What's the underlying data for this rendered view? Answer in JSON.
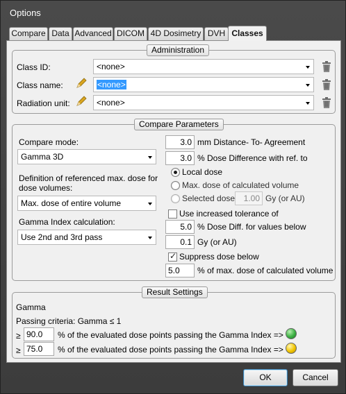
{
  "window": {
    "title": "Options"
  },
  "tabs": [
    {
      "label": "Compare"
    },
    {
      "label": "Data"
    },
    {
      "label": "Advanced"
    },
    {
      "label": "DICOM"
    },
    {
      "label": "4D Dosimetry"
    },
    {
      "label": "DVH"
    },
    {
      "label": "Classes"
    }
  ],
  "active_tab": "Classes",
  "administration": {
    "title": "Administration",
    "class_id": {
      "label": "Class ID:",
      "value": "<none>"
    },
    "class_name": {
      "label": "Class name:",
      "value": "<none>"
    },
    "radiation_unit": {
      "label": "Radiation unit:",
      "value": "<none>"
    }
  },
  "compare": {
    "title": "Compare Parameters",
    "mode_label": "Compare mode:",
    "mode_value": "Gamma 3D",
    "def_label_1": "Definition of referenced max. dose for",
    "def_label_2": "dose volumes:",
    "def_value": "Max. dose of entire volume",
    "gamma_calc_label": "Gamma Index calculation:",
    "gamma_calc_value": "Use 2nd and 3rd pass",
    "dta_value": "3.0",
    "dta_label": "mm Distance- To- Agreement",
    "dd_value": "3.0",
    "dd_label": "% Dose Difference with ref. to",
    "local_dose_label": "Local dose",
    "max_calc_label": "Max. dose of calculated volume",
    "selected_dose_label": "Selected dose",
    "selected_dose_value": "1.00",
    "selected_dose_unit": "Gy (or AU)",
    "increased_tol_label": "Use increased tolerance of",
    "tol_diff_value": "5.0",
    "tol_diff_label": "% Dose Diff. for values below",
    "tol_gy_value": "0.1",
    "tol_gy_label": "Gy (or AU)",
    "suppress_label": "Suppress dose below",
    "suppress_value": "5.0",
    "suppress_unit": "% of max. dose of calculated volume",
    "radio_selected": "local",
    "increased_tol_checked": false,
    "suppress_checked": true
  },
  "result": {
    "title": "Result Settings",
    "heading": "Gamma",
    "passing": "Passing criteria: Gamma ≤ 1",
    "rows": [
      {
        "sym": "≥",
        "value": "90.0",
        "text": "% of the evaluated dose points passing the Gamma Index  =>",
        "color": "#3cb043"
      },
      {
        "sym": "≥",
        "value": "75.0",
        "text": "% of the evaluated dose points passing the Gamma Index  =>",
        "color": "#f2c500"
      }
    ]
  },
  "buttons": {
    "ok": "OK",
    "cancel": "Cancel"
  },
  "colors": {
    "title_bar": "#3c3c3c",
    "selection": "#3399ff",
    "led_green": "#3cb043",
    "led_yellow": "#f2c500"
  }
}
